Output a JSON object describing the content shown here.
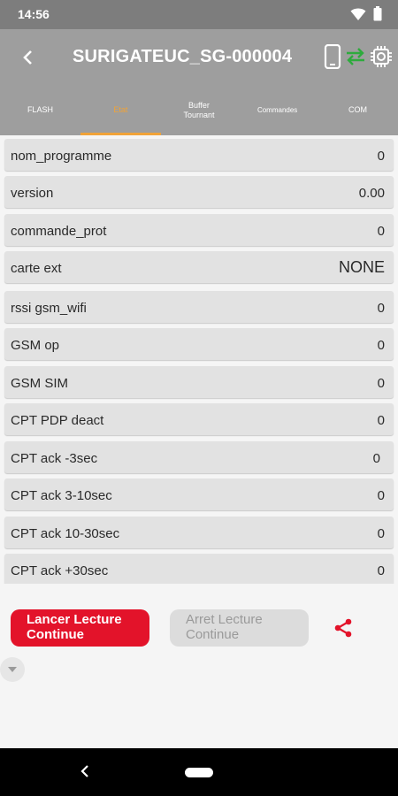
{
  "status_bar": {
    "time": "14:56"
  },
  "app_bar": {
    "title": "SURIGATEUC_SG-000004"
  },
  "tabs": [
    {
      "label": "FLASH",
      "active": false
    },
    {
      "label": "Etat",
      "active": true
    },
    {
      "label": "Buffer Tournant",
      "active": false
    },
    {
      "label": "Commandes",
      "active": false
    },
    {
      "label": "COM",
      "active": false
    }
  ],
  "rows": [
    {
      "label": "nom_programme",
      "value": "0"
    },
    {
      "label": "version",
      "value": "0.00"
    },
    {
      "label": "commande_prot",
      "value": "0"
    },
    {
      "label": "carte ext",
      "value": "NONE"
    },
    {
      "label": "rssi gsm_wifi",
      "value": "0"
    },
    {
      "label": "GSM op",
      "value": "0"
    },
    {
      "label": "GSM SIM",
      "value": "0"
    },
    {
      "label": "CPT PDP deact",
      "value": "0"
    },
    {
      "label": "CPT ack -3sec",
      "value": "0"
    },
    {
      "label": "CPT ack 3-10sec",
      "value": "0"
    },
    {
      "label": "CPT ack 10-30sec",
      "value": "0"
    },
    {
      "label": "CPT ack +30sec",
      "value": "0"
    }
  ],
  "actions": {
    "start_label": "Lancer Lecture Continue",
    "stop_label": "Arret Lecture Continue"
  },
  "colors": {
    "accent": "#e3132a",
    "tab_active": "#f0a338",
    "app_bar": "#9e9e9e",
    "sync_icon": "#2eab3d"
  },
  "icons": [
    "wifi-icon",
    "battery-icon",
    "back-arrow-icon",
    "phone-icon",
    "sync-arrows-icon",
    "chip-settings-icon",
    "share-icon",
    "chevron-down-icon",
    "nav-back-icon",
    "nav-home-pill"
  ]
}
